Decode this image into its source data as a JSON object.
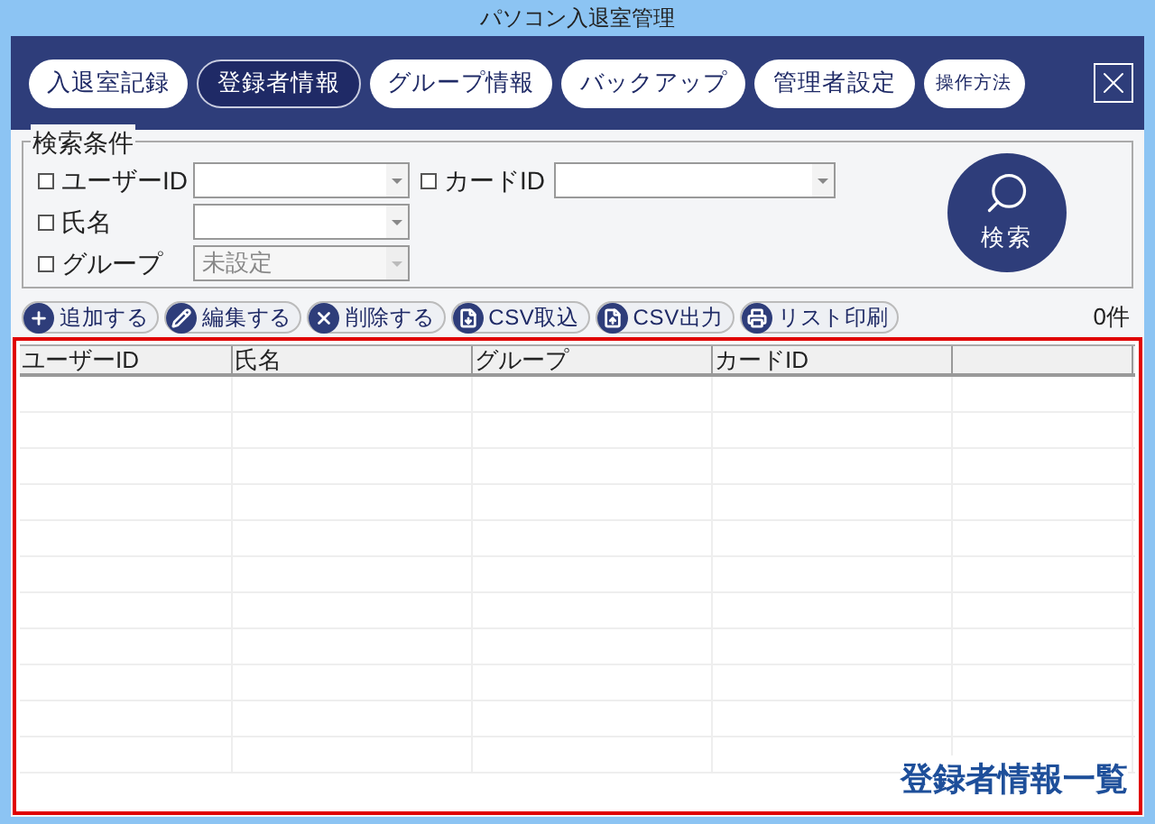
{
  "window": {
    "title": "パソコン入退室管理"
  },
  "nav_tabs": [
    {
      "label": "入退室記録",
      "selected": false
    },
    {
      "label": "登録者情報",
      "selected": true
    },
    {
      "label": "グループ情報",
      "selected": false
    },
    {
      "label": "バックアップ",
      "selected": false
    },
    {
      "label": "管理者設定",
      "selected": false
    },
    {
      "label": "操作方法",
      "selected": false,
      "kind": "small"
    }
  ],
  "search": {
    "legend": "検索条件",
    "button": "検索",
    "fields": [
      {
        "label": "ユーザーID",
        "checked": false,
        "disabled": false
      },
      {
        "label": "カードID",
        "checked": false,
        "disabled": false
      },
      {
        "label": "氏名",
        "checked": false,
        "disabled": false
      },
      {
        "label": "グループ",
        "checked": false,
        "disabled": true,
        "value": "未設定"
      }
    ]
  },
  "toolbar": [
    {
      "label": "追加する",
      "kind": "plus"
    },
    {
      "label": "編集する",
      "kind": "pencil"
    },
    {
      "label": "削除する",
      "kind": "delete"
    },
    {
      "label": "CSV取込",
      "kind": "import"
    },
    {
      "label": "CSV出力",
      "kind": "export"
    },
    {
      "label": "リスト印刷",
      "kind": "print"
    }
  ],
  "count": "0件",
  "table": {
    "columns": [
      "ユーザーID",
      "氏名",
      "グループ",
      "カードID"
    ]
  },
  "caption": "登録者情報一覧"
}
